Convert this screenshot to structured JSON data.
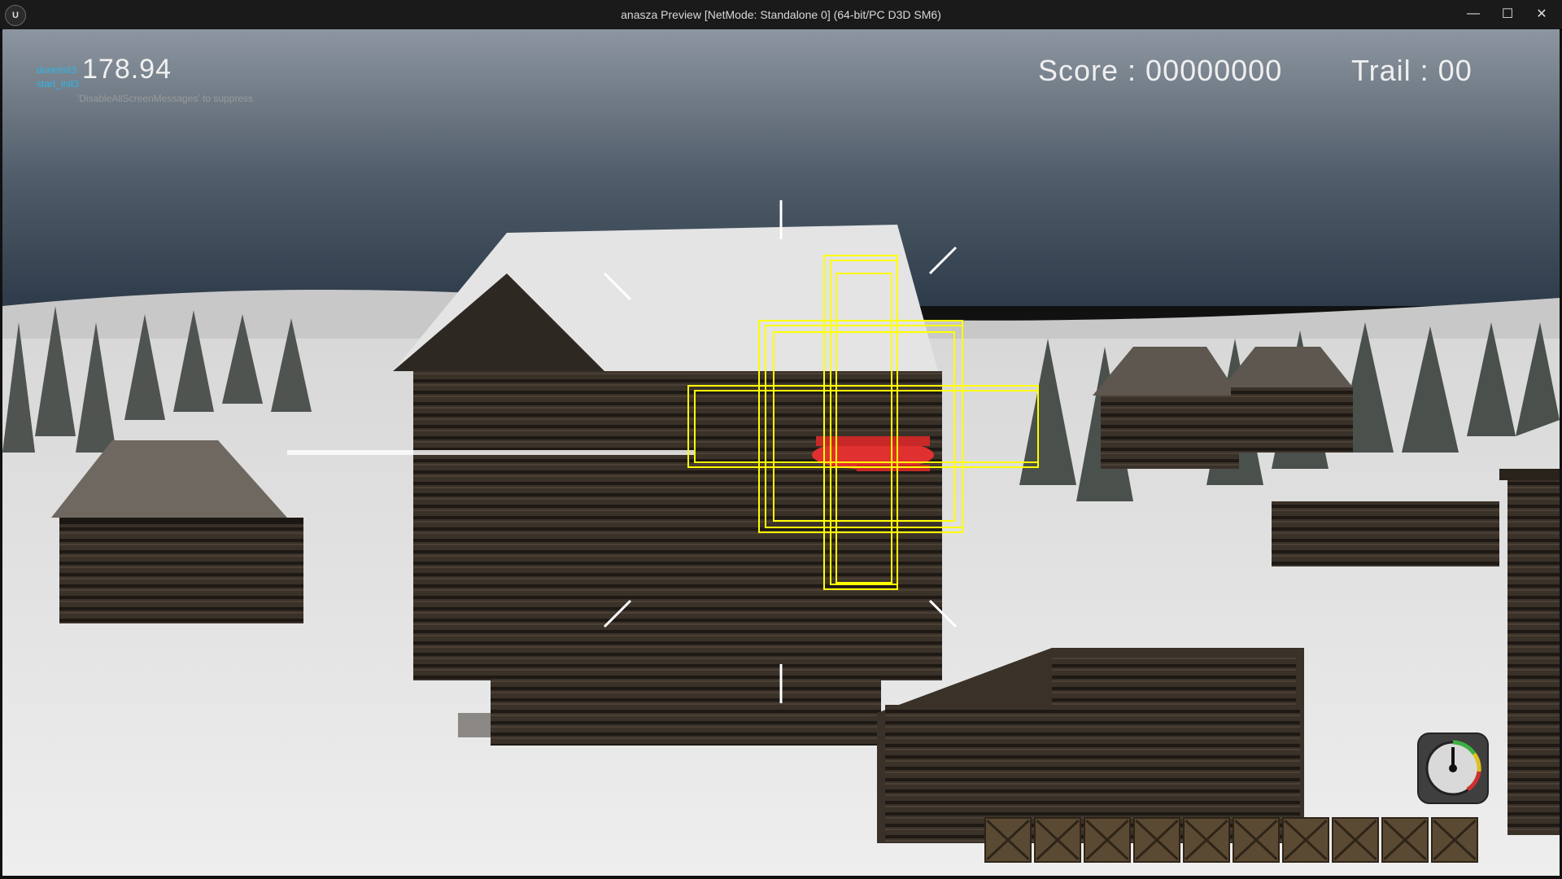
{
  "window": {
    "title": "anasza Preview [NetMode: Standalone 0]  (64-bit/PC D3D SM6)",
    "logo_text": "U",
    "minimize_icon": "—",
    "maximize_icon": "☐",
    "close_icon": "✕"
  },
  "hud": {
    "debug_lines": [
      "doneInit3",
      "start_init3"
    ],
    "timer": "178.94",
    "suppress_message": "'DisableAllScreenMessages' to suppress",
    "score_label": "Score : 00000000",
    "trail_label": "Trail : 00",
    "hotbar_slot_count": 10,
    "hotbar_item_icon": "wooden-crate-icon",
    "gauge_icon": "speedometer-gauge-icon"
  },
  "colors": {
    "crosshair": "#ffffff",
    "target_box": "#ffff00",
    "debug_text": "#2cb6e8",
    "plane": "#e03030"
  }
}
